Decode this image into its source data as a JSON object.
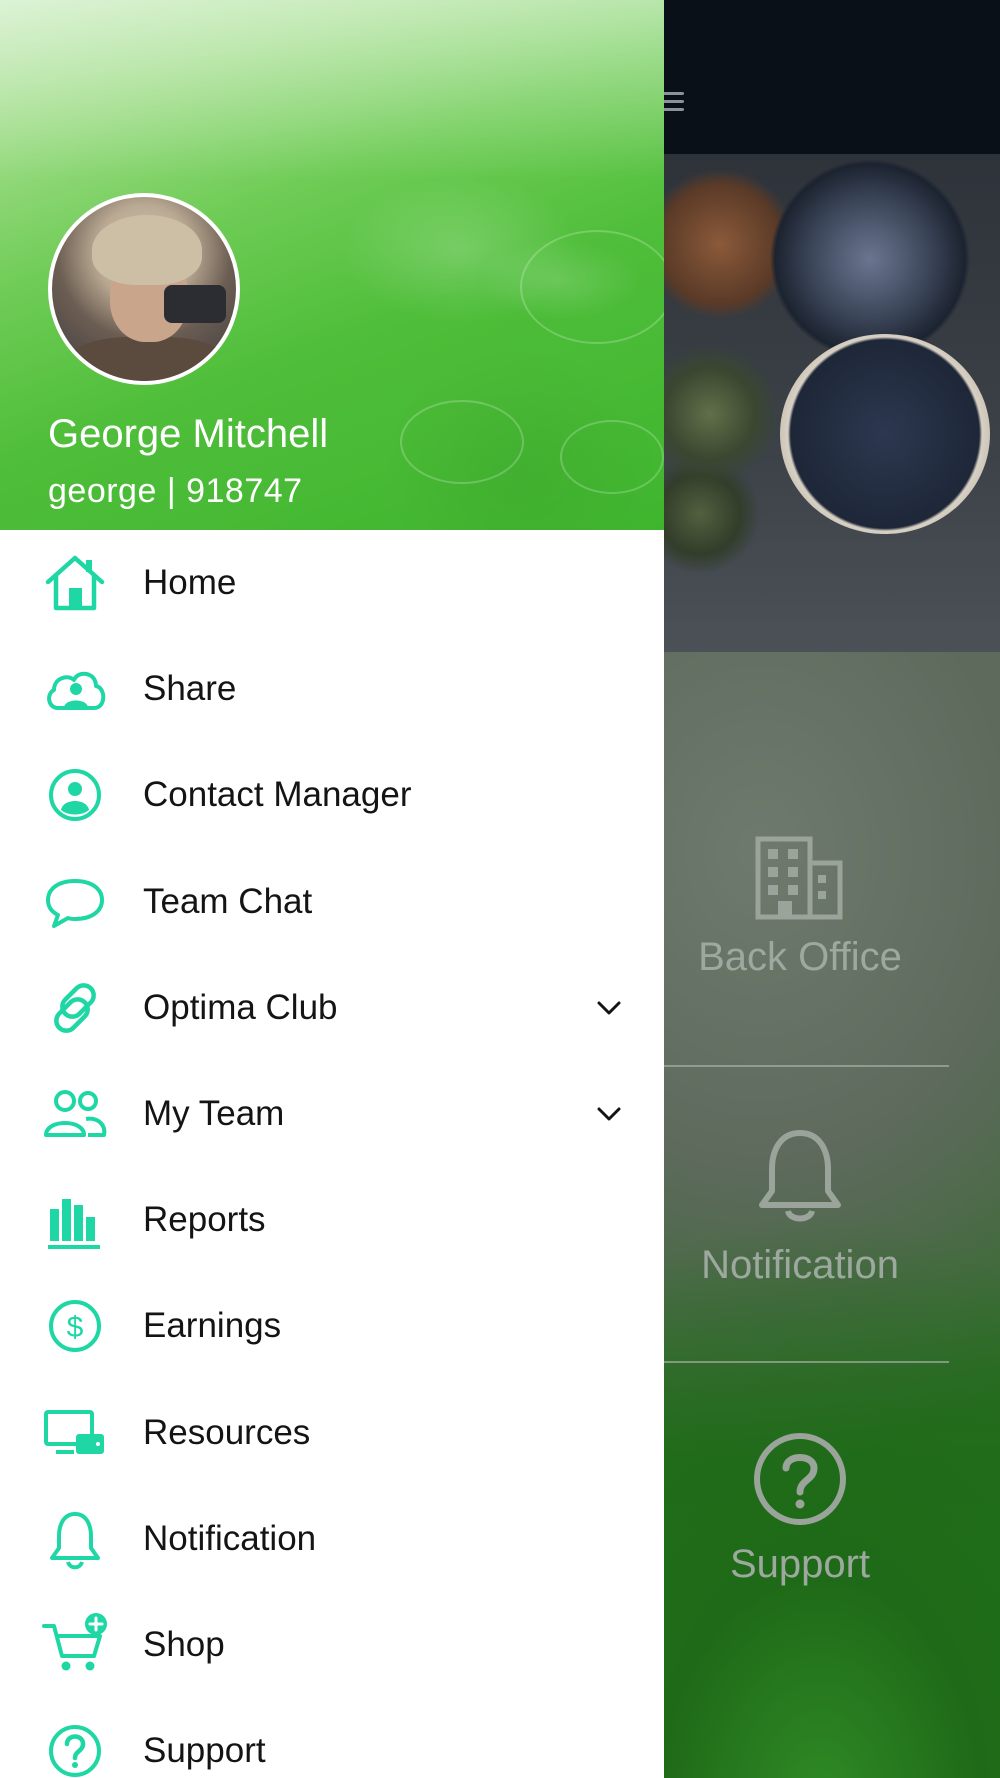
{
  "profile": {
    "name": "George Mitchell",
    "subtitle": "george | 918747"
  },
  "menu": {
    "items": [
      {
        "label": "Home",
        "icon": "home-icon",
        "expandable": false
      },
      {
        "label": "Share",
        "icon": "cloud-user-icon",
        "expandable": false
      },
      {
        "label": "Contact Manager",
        "icon": "contact-icon",
        "expandable": false
      },
      {
        "label": "Team Chat",
        "icon": "chat-bubble-icon",
        "expandable": false
      },
      {
        "label": "Optima Club",
        "icon": "link-icon",
        "expandable": true
      },
      {
        "label": "My Team",
        "icon": "team-icon",
        "expandable": true
      },
      {
        "label": "Reports",
        "icon": "bar-chart-icon",
        "expandable": false
      },
      {
        "label": "Earnings",
        "icon": "dollar-icon",
        "expandable": false
      },
      {
        "label": "Resources",
        "icon": "devices-icon",
        "expandable": false
      },
      {
        "label": "Notification",
        "icon": "bell-icon",
        "expandable": false
      },
      {
        "label": "Shop",
        "icon": "cart-plus-icon",
        "expandable": false
      },
      {
        "label": "Support",
        "icon": "help-icon",
        "expandable": false
      }
    ]
  },
  "background": {
    "tiles": [
      {
        "label": "Back Office",
        "icon": "building-icon"
      },
      {
        "label": "Notification",
        "icon": "bell-icon"
      },
      {
        "label": "Support",
        "icon": "help-icon"
      }
    ]
  },
  "colors": {
    "accent": "#1ed7a4",
    "drawer_bg": "#ffffff",
    "topbar": "#0a1018",
    "header_green": "#4fbe3a"
  }
}
